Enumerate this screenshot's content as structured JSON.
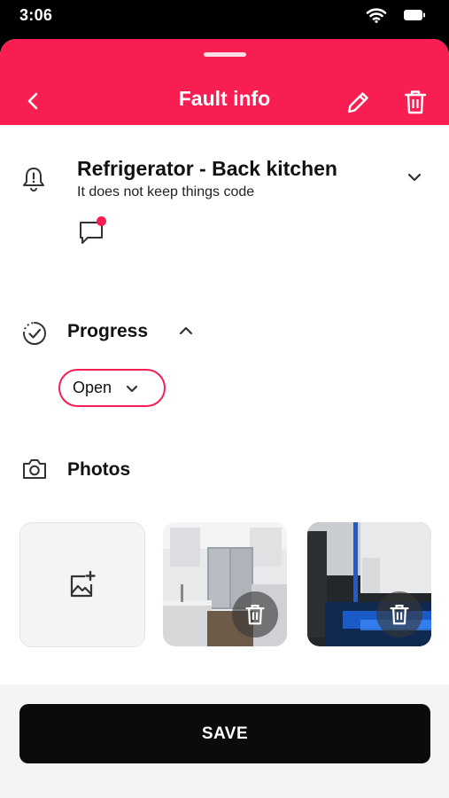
{
  "status_bar": {
    "time": "3:06",
    "icons": [
      "wifi-icon",
      "battery-icon"
    ]
  },
  "header": {
    "title": "Fault info",
    "accent_color": "#F81E52",
    "icons": [
      "back-chevron-icon",
      "pencil-icon",
      "trash-icon"
    ]
  },
  "fault": {
    "title": "Refrigerator - Back kitchen",
    "description": "It does not keep things code",
    "icons": [
      "alert-bell-icon",
      "chevron-down-icon",
      "comment-icon"
    ],
    "comment_unread": true
  },
  "progress": {
    "label": "Progress",
    "status_value": "Open",
    "icons": [
      "progress-check-icon",
      "chevron-up-icon",
      "chevron-down-icon"
    ]
  },
  "photos": {
    "label": "Photos",
    "add_icon": "add-photo-icon",
    "items": [
      {
        "subject": "white kitchen with stainless refrigerator"
      },
      {
        "subject": "dark kitchen with blue lit open refrigerator"
      }
    ]
  },
  "footer": {
    "save_label": "SAVE"
  }
}
